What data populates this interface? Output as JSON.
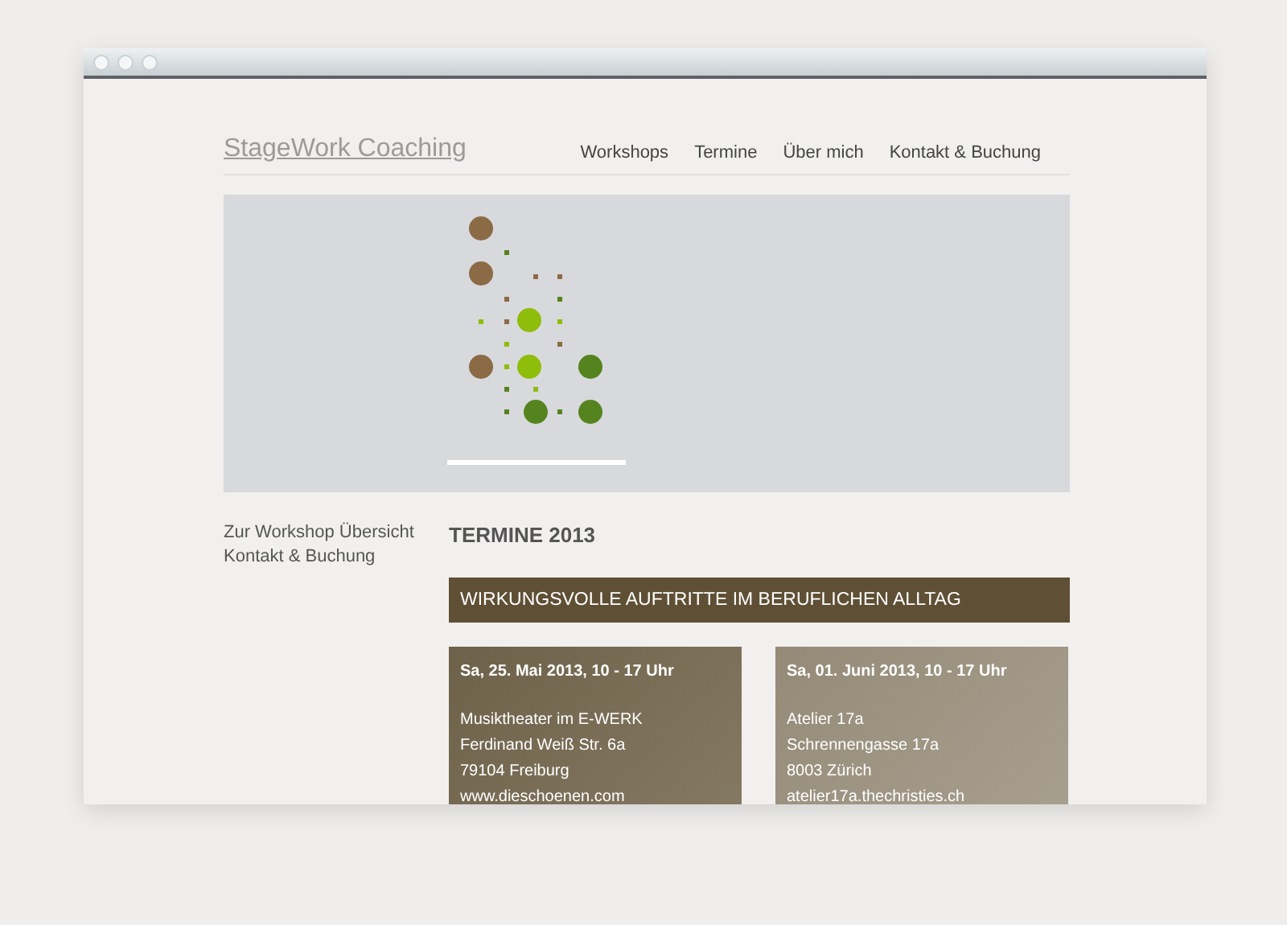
{
  "site": {
    "title": "StageWork Coaching"
  },
  "nav": [
    {
      "label": "Workshops"
    },
    {
      "label": "Termine"
    },
    {
      "label": "Über mich"
    },
    {
      "label": "Kontakt & Buchung"
    }
  ],
  "sidebar": {
    "links": [
      "Zur Workshop Übersicht",
      "Kontakt & Buchung"
    ]
  },
  "heading": "TERMINE 2013",
  "banner": "WIRKUNGSVOLLE AUFTRITTE IM BERUFLICHEN ALLTAG",
  "events": [
    {
      "date": "Sa, 25. Mai 2013, 10 - 17 Uhr",
      "lines": [
        "Musiktheater im E-WERK",
        "Ferdinand Weiß Str. 6a",
        "79104 Freiburg",
        "www.dieschoenen.com"
      ]
    },
    {
      "date": "Sa, 01. Juni 2013, 10 - 17 Uhr",
      "lines": [
        "Atelier 17a",
        "Schrennengasse 17a",
        "8003 Zürich",
        "atelier17a.thechristies.ch"
      ]
    }
  ]
}
